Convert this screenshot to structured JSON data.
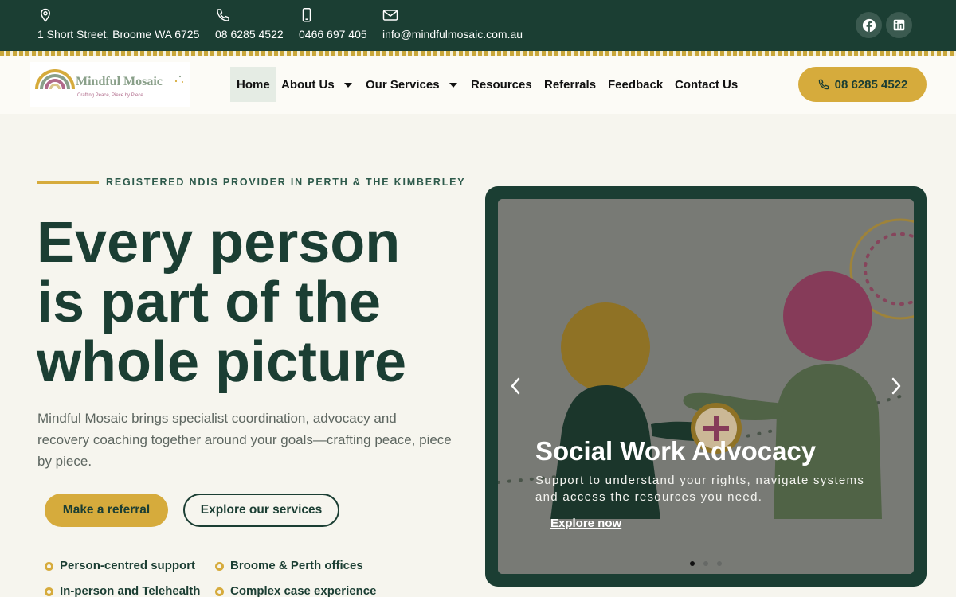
{
  "topbar": {
    "address": "1 Short Street, Broome WA 6725",
    "phone": "08 6285 4522",
    "mobile": "0466 697 405",
    "email": "info@mindfulmosaic.com.au",
    "icons": [
      "location-pin-icon",
      "phone-icon",
      "mobile-icon",
      "mail-icon",
      "facebook-icon",
      "linkedin-icon"
    ]
  },
  "brand": {
    "name": "Mindful Mosaic",
    "tagline": "Crafting Peace, Piece by Piece"
  },
  "nav": {
    "home": "Home",
    "about": "About Us",
    "services": "Our Services",
    "resources": "Resources",
    "referrals": "Referrals",
    "feedback": "Feedback",
    "contact": "Contact Us",
    "call_label": "08 6285 4522"
  },
  "hero": {
    "eyebrow": "REGISTERED NDIS PROVIDER IN PERTH & THE KIMBERLEY",
    "headline": [
      "Every person",
      "is part of the",
      "whole picture"
    ],
    "lede": "Mindful Mosaic brings specialist coordination, advocacy and recovery coaching together around your goals—crafting peace, piece by piece.",
    "primary_cta": "Make a referral",
    "secondary_cta": "Explore our services",
    "features": [
      "Person-centred support",
      "Broome & Perth offices",
      "In-person and Telehealth",
      "Complex case experience"
    ]
  },
  "slider": {
    "title": "Social Work Advocacy",
    "text": "Support to understand your rights, navigate systems and access the resources you need.",
    "link": "Explore now",
    "active_slide": 1,
    "slide_count": 3
  },
  "colors": {
    "dark_green": "#1b3e33",
    "gold": "#d6ab3c",
    "background": "#f6f5ee",
    "plum": "#8f3f5f",
    "sage": "#566a4b"
  }
}
